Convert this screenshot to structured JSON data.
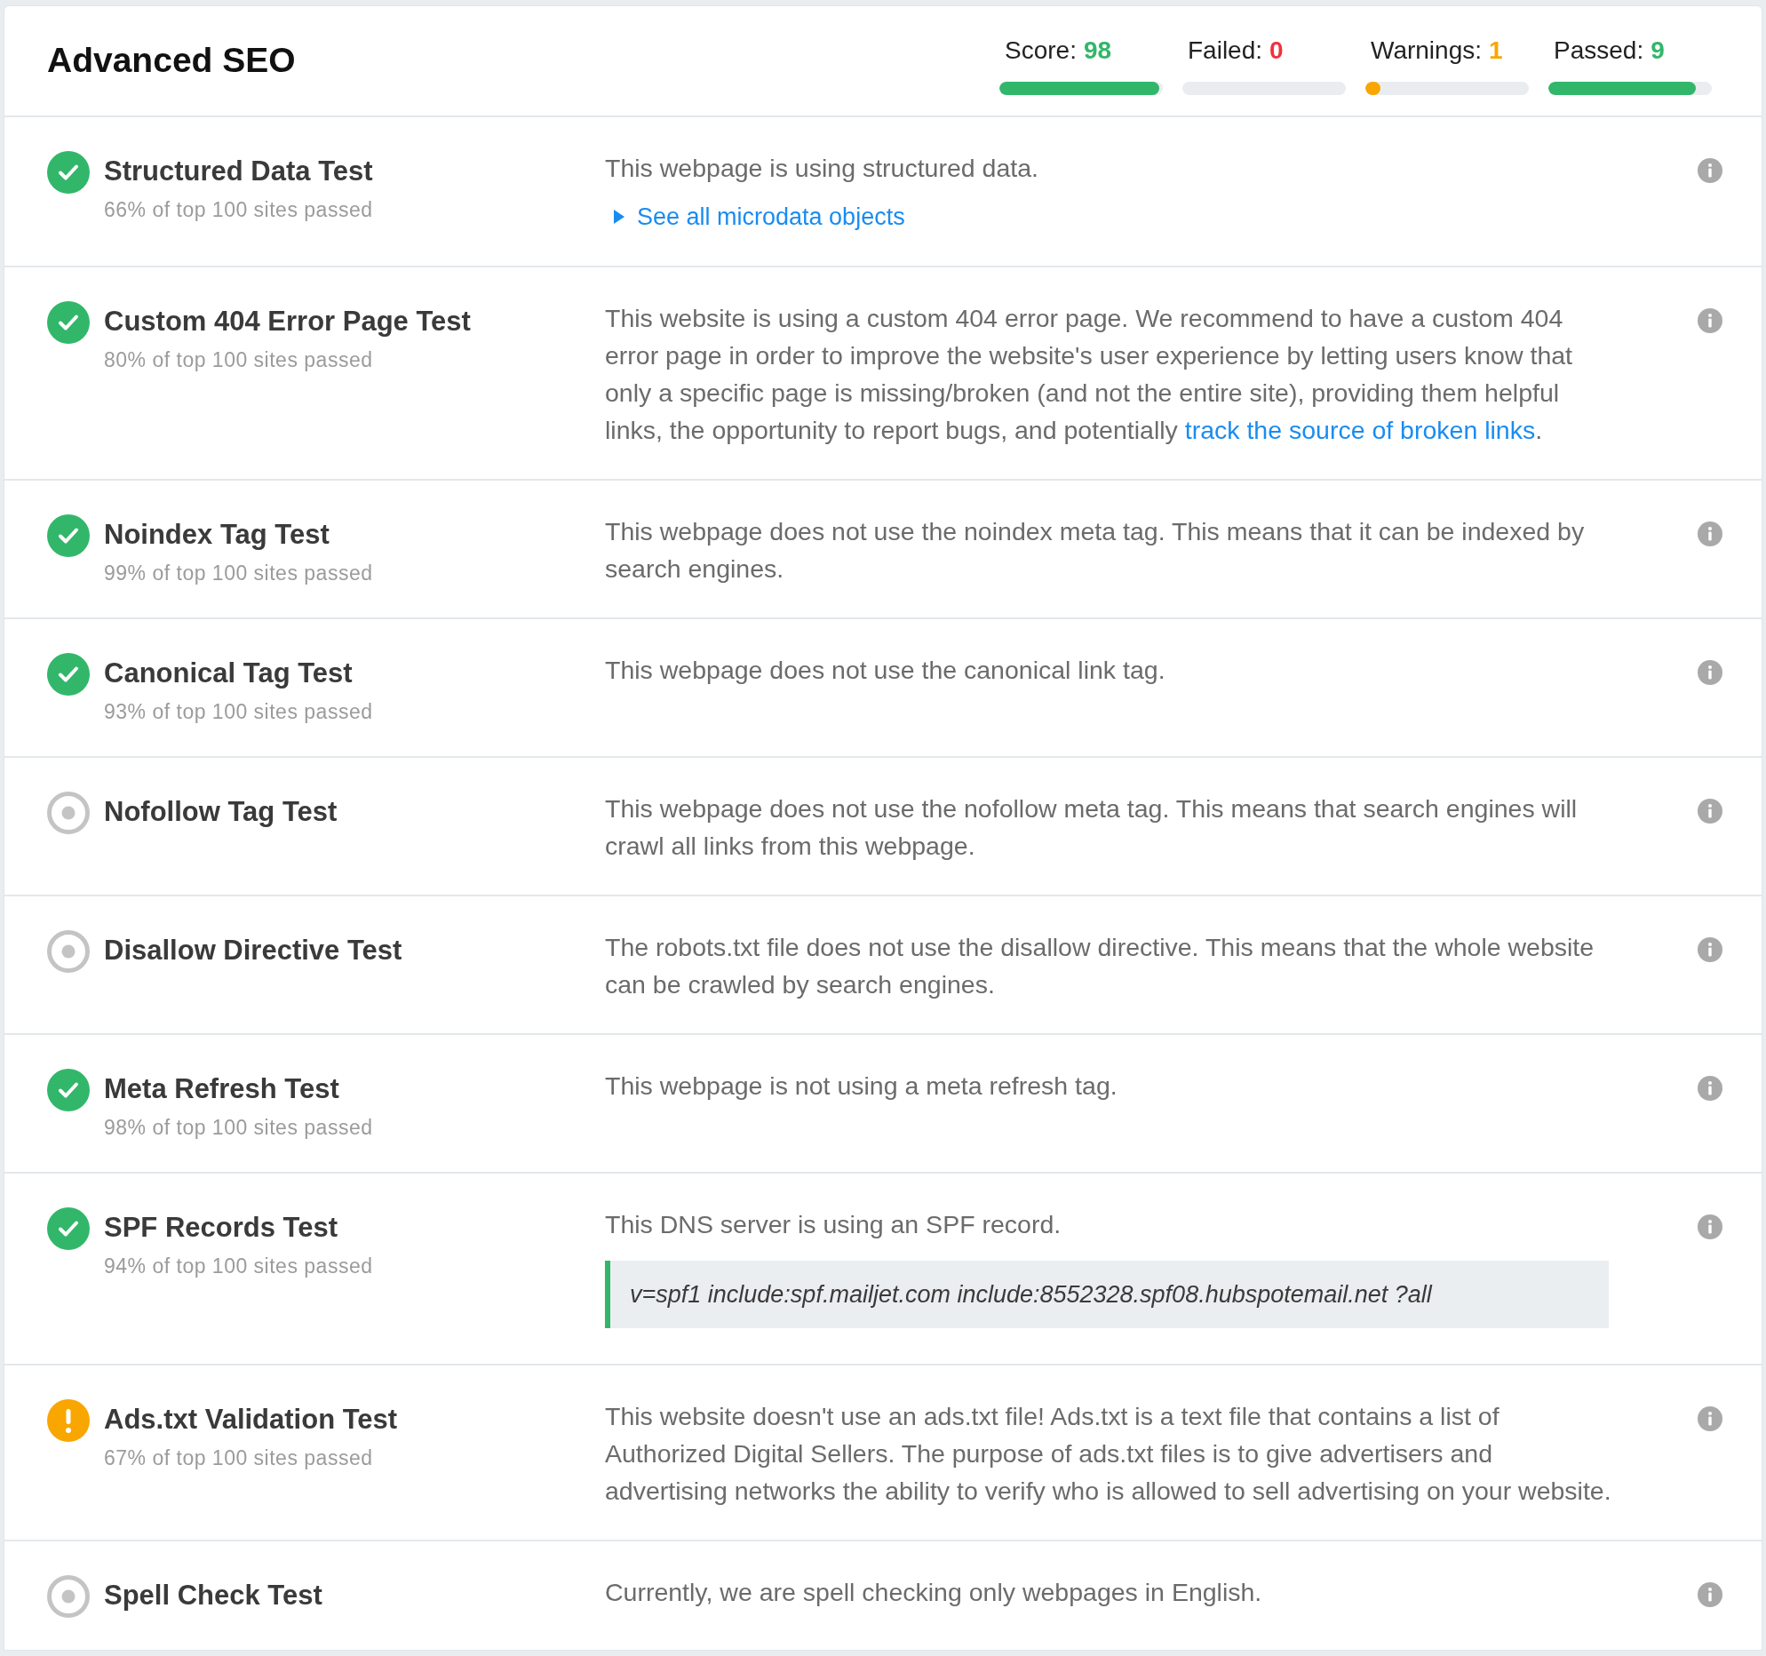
{
  "title": "Advanced SEO",
  "stats": [
    {
      "label": "Score:",
      "value": "98",
      "kind": "score",
      "level": 0.98
    },
    {
      "label": "Failed:",
      "value": "0",
      "kind": "failed"
    },
    {
      "label": "Warnings:",
      "value": "1",
      "kind": "warning",
      "level": 0.09
    },
    {
      "label": "Passed:",
      "value": "9",
      "kind": "passed",
      "level": 0.9
    }
  ],
  "tests": [
    {
      "name": "Structured Data Test",
      "kind": "passed",
      "subtitle": "66% of top 100 sites passed",
      "description": [
        {
          "kind": "text",
          "text": "This webpage is using structured data."
        }
      ],
      "expander": "See all microdata objects"
    },
    {
      "name": "Custom 404 Error Page Test",
      "kind": "passed",
      "subtitle": "80% of top 100 sites passed",
      "description": [
        {
          "kind": "text",
          "text": "This website is using a custom 404 error page. We recommend to have a custom 404 error page in order to improve the website's user experience by letting users know that only a specific page is missing/broken (and not the entire site), providing them helpful links, the opportunity to report bugs, and potentially "
        },
        {
          "kind": "link",
          "text": "track the source of broken links"
        },
        {
          "kind": "text",
          "text": "."
        }
      ]
    },
    {
      "name": "Noindex Tag Test",
      "kind": "passed",
      "subtitle": "99% of top 100 sites passed",
      "description": [
        {
          "kind": "text",
          "text": "This webpage does not use the noindex meta tag. This means that it can be indexed by search engines."
        }
      ]
    },
    {
      "name": "Canonical Tag Test",
      "kind": "passed",
      "subtitle": "93% of top 100 sites passed",
      "description": [
        {
          "kind": "text",
          "text": "This webpage does not use the canonical link tag."
        }
      ]
    },
    {
      "name": "Nofollow Tag Test",
      "kind": "info",
      "description": [
        {
          "kind": "text",
          "text": "This webpage does not use the nofollow meta tag. This means that search engines will crawl all links from this webpage."
        }
      ]
    },
    {
      "name": "Disallow Directive Test",
      "kind": "info",
      "description": [
        {
          "kind": "text",
          "text": "The robots.txt file does not use the disallow directive. This means that the whole website can be crawled by search engines."
        }
      ]
    },
    {
      "name": "Meta Refresh Test",
      "kind": "passed",
      "subtitle": "98% of top 100 sites passed",
      "description": [
        {
          "kind": "text",
          "text": "This webpage is not using a meta refresh tag."
        }
      ]
    },
    {
      "name": "SPF Records Test",
      "kind": "passed",
      "subtitle": "94% of top 100 sites passed",
      "description": [
        {
          "kind": "text",
          "text": "This DNS server is using an SPF record."
        }
      ],
      "code": "v=spf1 include:spf.mailjet.com include:8552328.spf08.hubspotemail.net ?all"
    },
    {
      "name": "Ads.txt Validation Test",
      "kind": "warning",
      "subtitle": "67% of top 100 sites passed",
      "description": [
        {
          "kind": "text",
          "text": "This website doesn't use an ads.txt file! Ads.txt is a text file that contains a list of Authorized Digital Sellers. The purpose of ads.txt files is to give advertisers and advertising networks the ability to verify who is allowed to sell advertising on your website."
        }
      ]
    },
    {
      "name": "Spell Check Test",
      "kind": "info",
      "description": [
        {
          "kind": "text",
          "text": "Currently, we are spell checking only webpages in English."
        }
      ]
    }
  ]
}
